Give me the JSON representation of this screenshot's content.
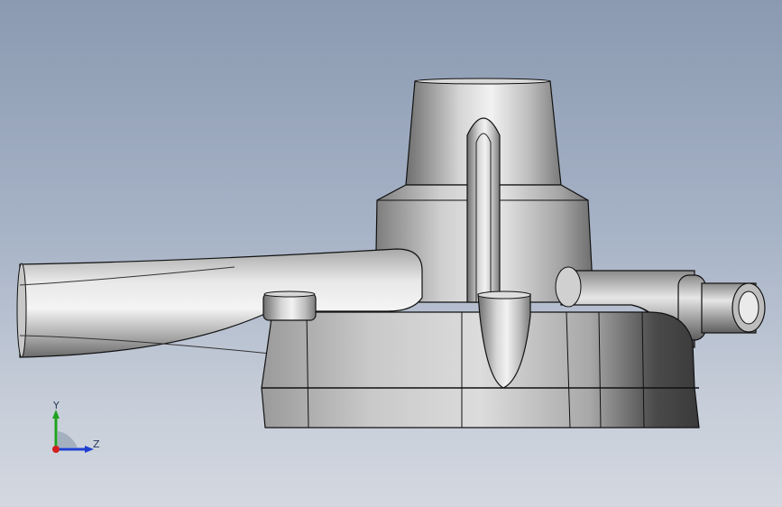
{
  "viewport": {
    "background_top": "#8b9ab1",
    "background_bottom": "#d3d8e0",
    "model_color": "#b9b9b9"
  },
  "triad": {
    "y_label": "Y",
    "z_label": "Z",
    "y_color": "#1fa31f",
    "z_color": "#1f3fd1",
    "x_color": "#d11f1f"
  }
}
